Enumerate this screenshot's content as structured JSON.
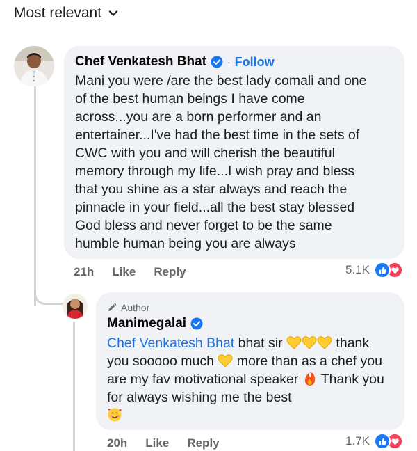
{
  "sort": {
    "label": "Most relevant",
    "icon": "chevron-down-icon"
  },
  "comment": {
    "author": "Chef Venkatesh Bhat",
    "verified_icon": "verified-badge-icon",
    "separator": "·",
    "follow_label": "Follow",
    "text": "Mani you were /are the best lady comali and one\nof the best human beings I have come\nacross...you are a born performer and an\nentertainer...I've had the  best time in the sets of\nCWC with you and will cherish the beautiful\nmemory through my life...I wish pray and bless\nthat you shine as a star always and reach the\npinnacle in your field...all the best stay blessed\nGod bless and never forget to be the same\nhumble human being you are always",
    "time": "21h",
    "like_label": "Like",
    "reply_label": "Reply",
    "reaction_count": "5.1K",
    "reaction_icons": [
      "like-icon",
      "love-icon"
    ]
  },
  "reply": {
    "badge_label": "Author",
    "badge_icon": "pencil-icon",
    "author": "Manimegalai",
    "verified_icon": "verified-badge-icon",
    "mention": "Chef Venkatesh Bhat",
    "text_1": " bhat sir ",
    "text_2": " thank you sooooo much ",
    "text_3": " more than as a chef you are my fav motivational speaker ",
    "text_4": " Thank you for always wishing me the best",
    "emojis": [
      "yellow-heart-emoji",
      "fire-emoji",
      "smiling-face-with-hearts-emoji"
    ],
    "time": "20h",
    "like_label": "Like",
    "reply_label": "Reply",
    "reaction_count": "1.7K",
    "reaction_icons": [
      "like-icon",
      "love-icon"
    ]
  },
  "colors": {
    "link_blue": "#1b74e4",
    "bubble_bg": "#f0f2f5",
    "meta_gray": "#65676b",
    "like_blue": "#1877f2",
    "love_red": "#f33e58"
  }
}
